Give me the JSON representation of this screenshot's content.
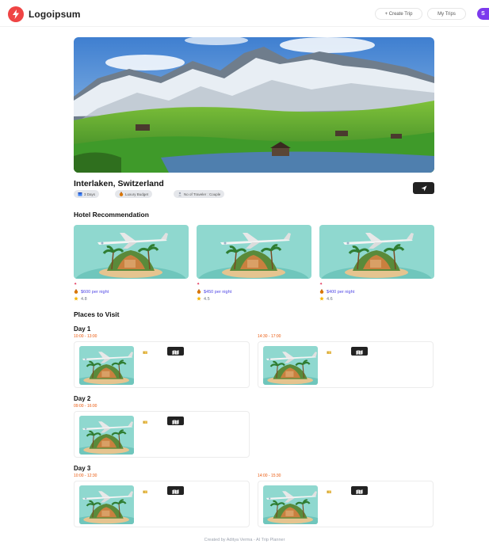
{
  "header": {
    "logo_text": "Logoipsum",
    "create_trip_label": "+ Create Trip",
    "my_trips_label": "My Trips",
    "avatar_initial": "S"
  },
  "trip": {
    "destination": "Interlaken, Switzerland",
    "days_chip": "3 Days",
    "budget_chip": "Luxury Budget",
    "travelers_chip": "No of Traveler : Couple"
  },
  "sections": {
    "hotels_title": "Hotel Recommendation",
    "places_title": "Places to Visit"
  },
  "hotels": [
    {
      "price": "$600 per night",
      "rating": "4.8"
    },
    {
      "price": "$450 per night",
      "rating": "4.5"
    },
    {
      "price": "$400 per night",
      "rating": "4.6"
    }
  ],
  "itinerary": [
    {
      "day": "Day 1",
      "slots": [
        "10:00 - 13:00",
        "14:30 - 17:00"
      ]
    },
    {
      "day": "Day 2",
      "slots": [
        "09:00 - 16:00"
      ]
    },
    {
      "day": "Day 3",
      "slots": [
        "10:00 - 12:30",
        "14:00 - 15:30"
      ]
    }
  ],
  "footer": {
    "text": "Created by Aditya Verma - AI Trip Planner"
  },
  "colors": {
    "brand": "#ef4444",
    "accent": "#4f46e5",
    "time": "#ea580c",
    "avatar": "#7c3aed"
  },
  "icons": [
    "logo-bolt-icon",
    "calendar-icon",
    "money-bag-icon",
    "send-icon",
    "pin-icon",
    "star-icon",
    "ticket-icon",
    "map-icon"
  ]
}
